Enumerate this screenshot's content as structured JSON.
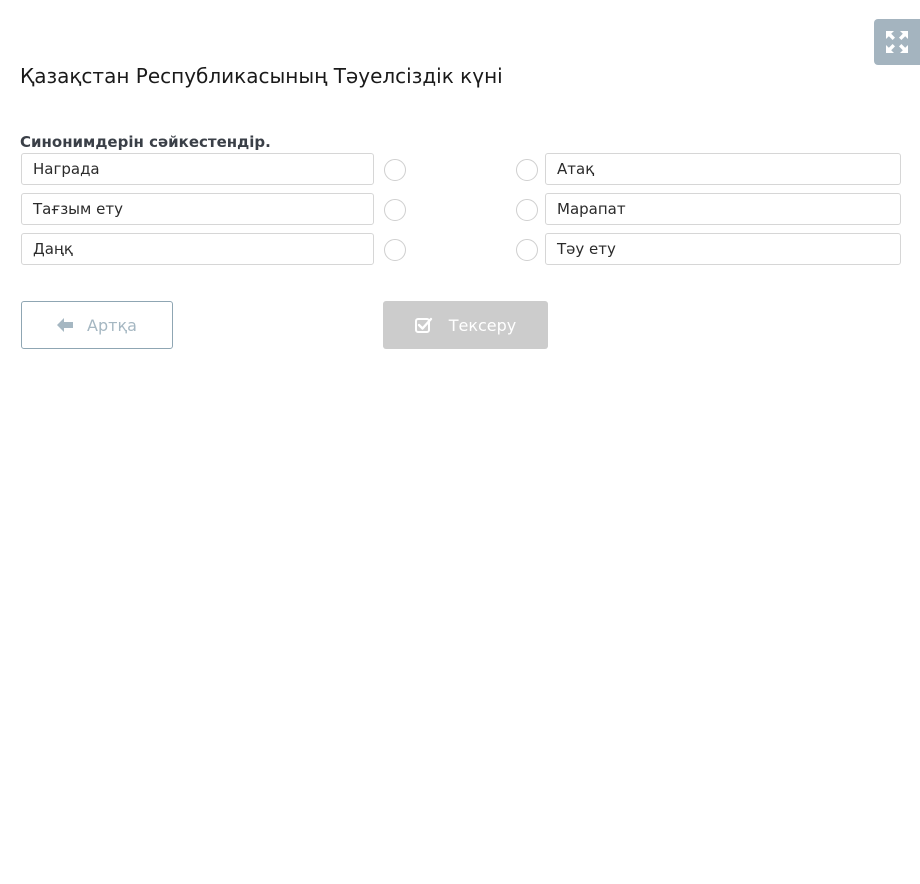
{
  "header": {
    "title": "Қазақстан Республикасының Тәуелсіздік күні",
    "fullscreen_icon": "expand-arrows-icon"
  },
  "task": {
    "instruction": "Синонимдерін сәйкестендір.",
    "left_items": [
      {
        "label": "Награда"
      },
      {
        "label": "Тағзым ету"
      },
      {
        "label": "Даңқ"
      }
    ],
    "right_items": [
      {
        "label": "Атақ"
      },
      {
        "label": "Марапат"
      },
      {
        "label": "Тәу ету"
      }
    ]
  },
  "buttons": {
    "back_label": "Артқа",
    "back_icon": "arrow-left-icon",
    "check_label": "Тексеру",
    "check_icon": "checkbox-checked-icon"
  },
  "colors": {
    "fullscreen_bg": "#a4b4bf",
    "back_border": "#8fa6b3",
    "check_bg": "#cccccc"
  }
}
